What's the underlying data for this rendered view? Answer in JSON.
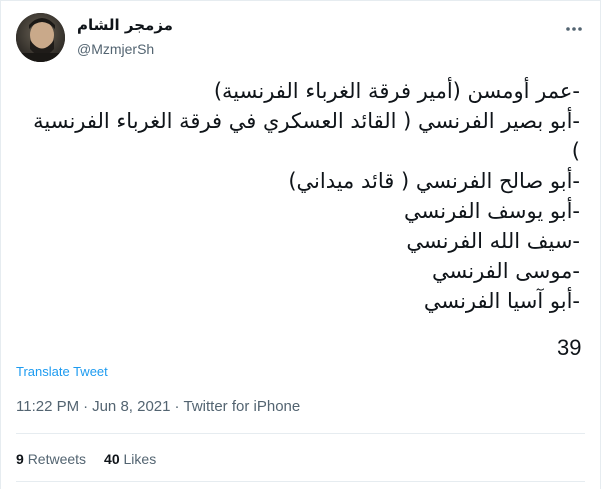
{
  "author": {
    "display_name": "مزمجر الشام",
    "handle": "@MzmjerSh"
  },
  "tweet": {
    "text": "-عمر أومسن (أمير فرقة الغرباء الفرنسية)\n-أبو بصير الفرنسي ( القائد العسكري في فرقة الغرباء الفرنسية )\n-أبو صالح الفرنسي ( قائد ميداني)\n-أبو يوسف الفرنسي\n-سيف الله الفرنسي\n-موسى الفرنسي\n-أبو آسيا الفرنسي",
    "number": "39",
    "translate_label": "Translate Tweet",
    "time": "11:22 PM",
    "date": "Jun 8, 2021",
    "separator": "·",
    "source": "Twitter for iPhone"
  },
  "stats": {
    "retweets_count": "9",
    "retweets_label": "Retweets",
    "likes_count": "40",
    "likes_label": "Likes"
  },
  "icons": {
    "more": "more-horizontal-icon"
  },
  "colors": {
    "link": "#1d9bf0",
    "muted": "#536471",
    "divider": "#e6ecf0"
  }
}
